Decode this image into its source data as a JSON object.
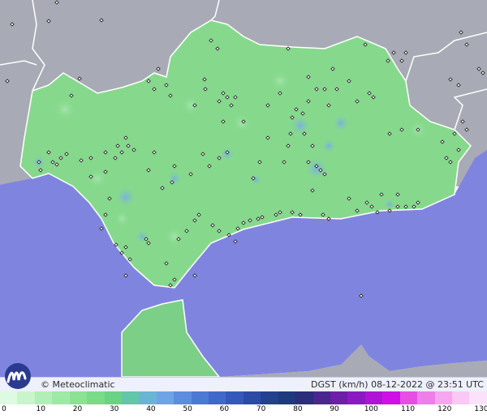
{
  "brand": "© Meteoclimatic",
  "footer_info": "DGST (km/h)   08-12-2022 @ 23:51 UTC",
  "logo_icon": "meteoclimatic-logo-icon",
  "colors": {
    "sea": "#7f85df",
    "land_outside": "#a8abb5",
    "region": "#86d98c",
    "border": "#ffffff"
  },
  "scale": {
    "labels": [
      "0",
      "10",
      "20",
      "30",
      "40",
      "50",
      "60",
      "70",
      "80",
      "90",
      "100",
      "110",
      "120",
      "130"
    ],
    "colors": [
      "#ddfbe0",
      "#c8f5cc",
      "#b2efb8",
      "#9ee9a6",
      "#8be295",
      "#78db87",
      "#68d483",
      "#62c6a9",
      "#68b6d4",
      "#6ea4e7",
      "#5c8de0",
      "#4d79d6",
      "#4168cb",
      "#3658bd",
      "#2c4aa8",
      "#23408f",
      "#1d3a7c",
      "#2b2e7c",
      "#4a2790",
      "#6c1fa8",
      "#8c1ac2",
      "#b013d6",
      "#d00fe6",
      "#e84de6",
      "#f07ee8",
      "#f5a6ef",
      "#f9c8f5",
      "#fbe1f9"
    ]
  }
}
